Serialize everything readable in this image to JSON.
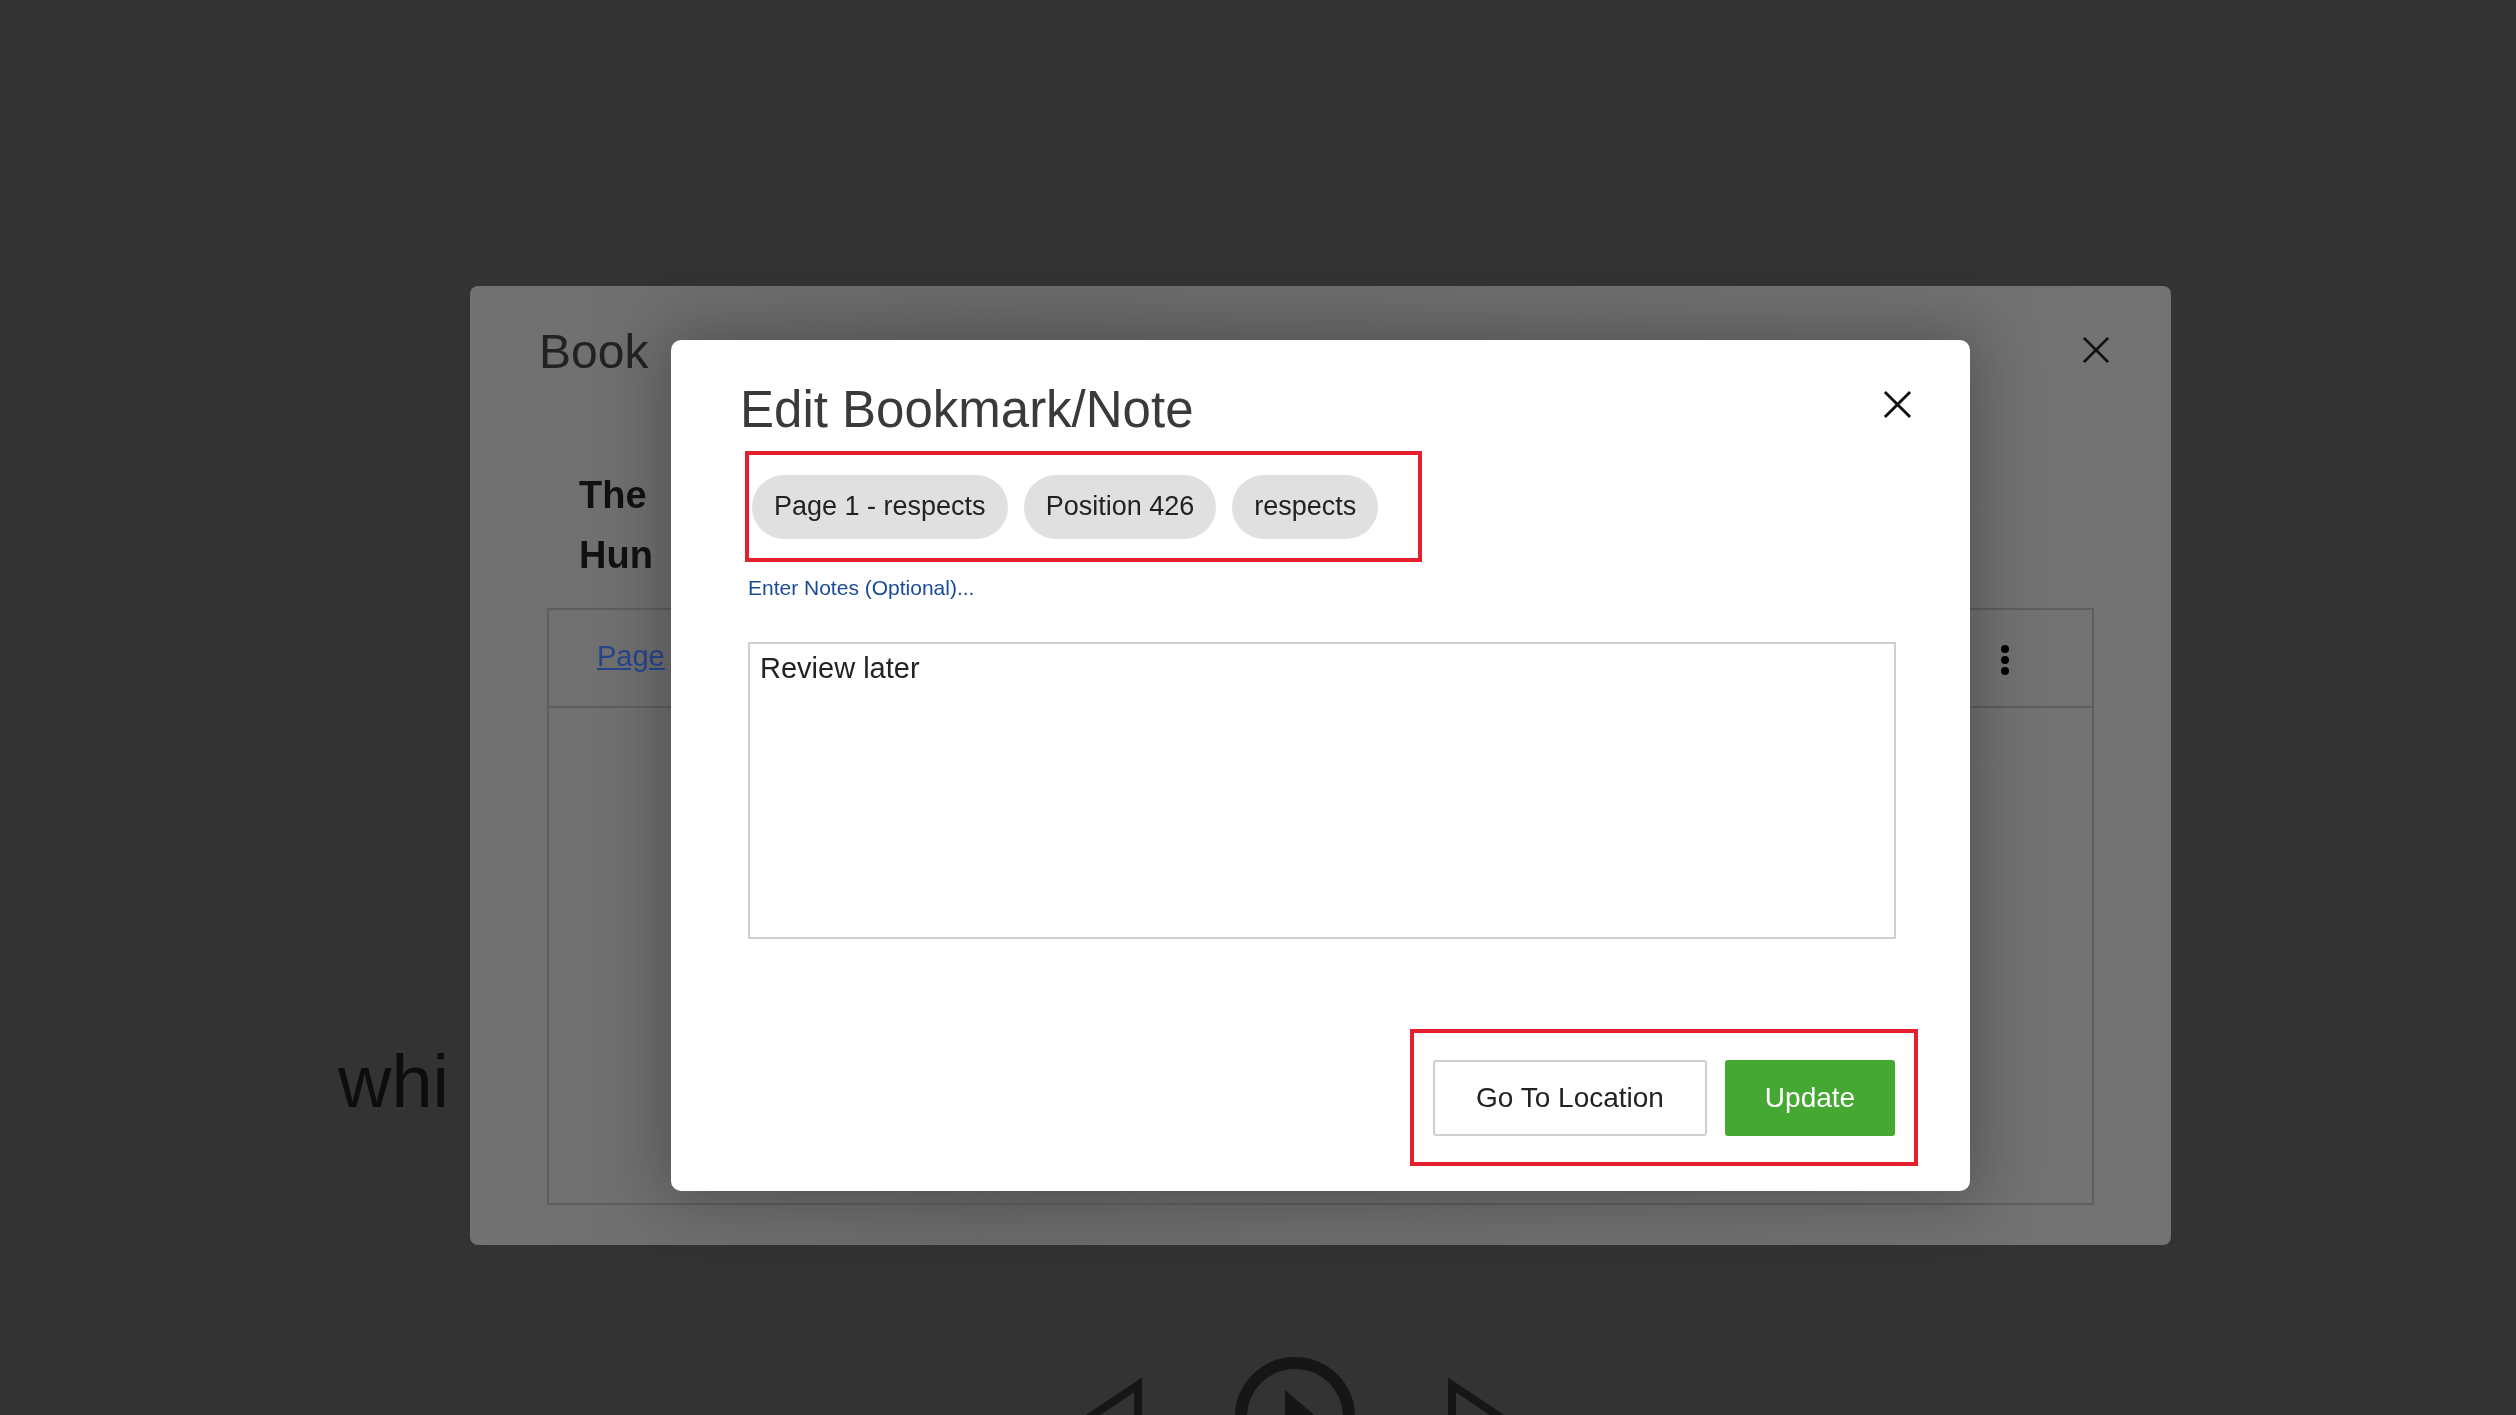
{
  "reader": {
    "text": "whi"
  },
  "bookmarks_dialog": {
    "title": "Book",
    "book_title_lines": [
      "The",
      "Hun"
    ],
    "bookmark_link": "Page"
  },
  "edit_dialog": {
    "title": "Edit Bookmark/Note",
    "tags": [
      "Page 1 - respects",
      "Position 426",
      "respects"
    ],
    "notes_label": "Enter Notes (Optional)...",
    "notes": {
      "value": "Review later"
    },
    "buttons": [
      {
        "label": "Go To Location",
        "kind": "secondary"
      },
      {
        "label": "Update",
        "kind": "primary"
      }
    ]
  }
}
